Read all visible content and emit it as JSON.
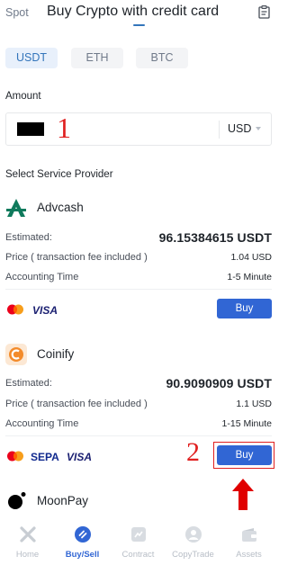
{
  "header": {
    "spot_tab": "Spot",
    "title_tab": "Buy Crypto with credit card",
    "order_icon": "order-list-icon"
  },
  "coin_tabs": [
    {
      "label": "USDT",
      "active": true
    },
    {
      "label": "ETH",
      "active": false
    },
    {
      "label": "BTC",
      "active": false
    }
  ],
  "amount": {
    "label": "Amount",
    "currency": "USD",
    "annotation": "1"
  },
  "providers_section": {
    "title": "Select Service Provider"
  },
  "providers": [
    {
      "name": "Advcash",
      "estimated_label": "Estimated:",
      "estimated_value": "96.15384615 USDT",
      "price_label": "Price ( transaction fee included )",
      "price_value": "1.04 USD",
      "time_label": "Accounting Time",
      "time_value": "1-5 Minute",
      "payment_methods": [
        "VISA"
      ],
      "buy_label": "Buy"
    },
    {
      "name": "Coinify",
      "estimated_label": "Estimated:",
      "estimated_value": "90.9090909 USDT",
      "price_label": "Price ( transaction fee included )",
      "price_value": "1.1 USD",
      "time_label": "Accounting Time",
      "time_value": "1-15 Minute",
      "payment_methods": [
        "SEPA",
        "VISA"
      ],
      "buy_label": "Buy"
    },
    {
      "name": "MoonPay"
    }
  ],
  "annotations": {
    "step2": "2"
  },
  "bottom_nav": [
    {
      "label": "Home",
      "icon": "home-icon",
      "active": false
    },
    {
      "label": "Buy/Sell",
      "icon": "buy-sell-icon",
      "active": true
    },
    {
      "label": "Contract",
      "icon": "contract-icon",
      "active": false
    },
    {
      "label": "CopyTrade",
      "icon": "copytrade-icon",
      "active": false
    },
    {
      "label": "Assets",
      "icon": "assets-icon",
      "active": false
    }
  ],
  "colors": {
    "accent": "#3375bb",
    "buy_button": "#3166d4",
    "annotation_red": "#e02020"
  }
}
